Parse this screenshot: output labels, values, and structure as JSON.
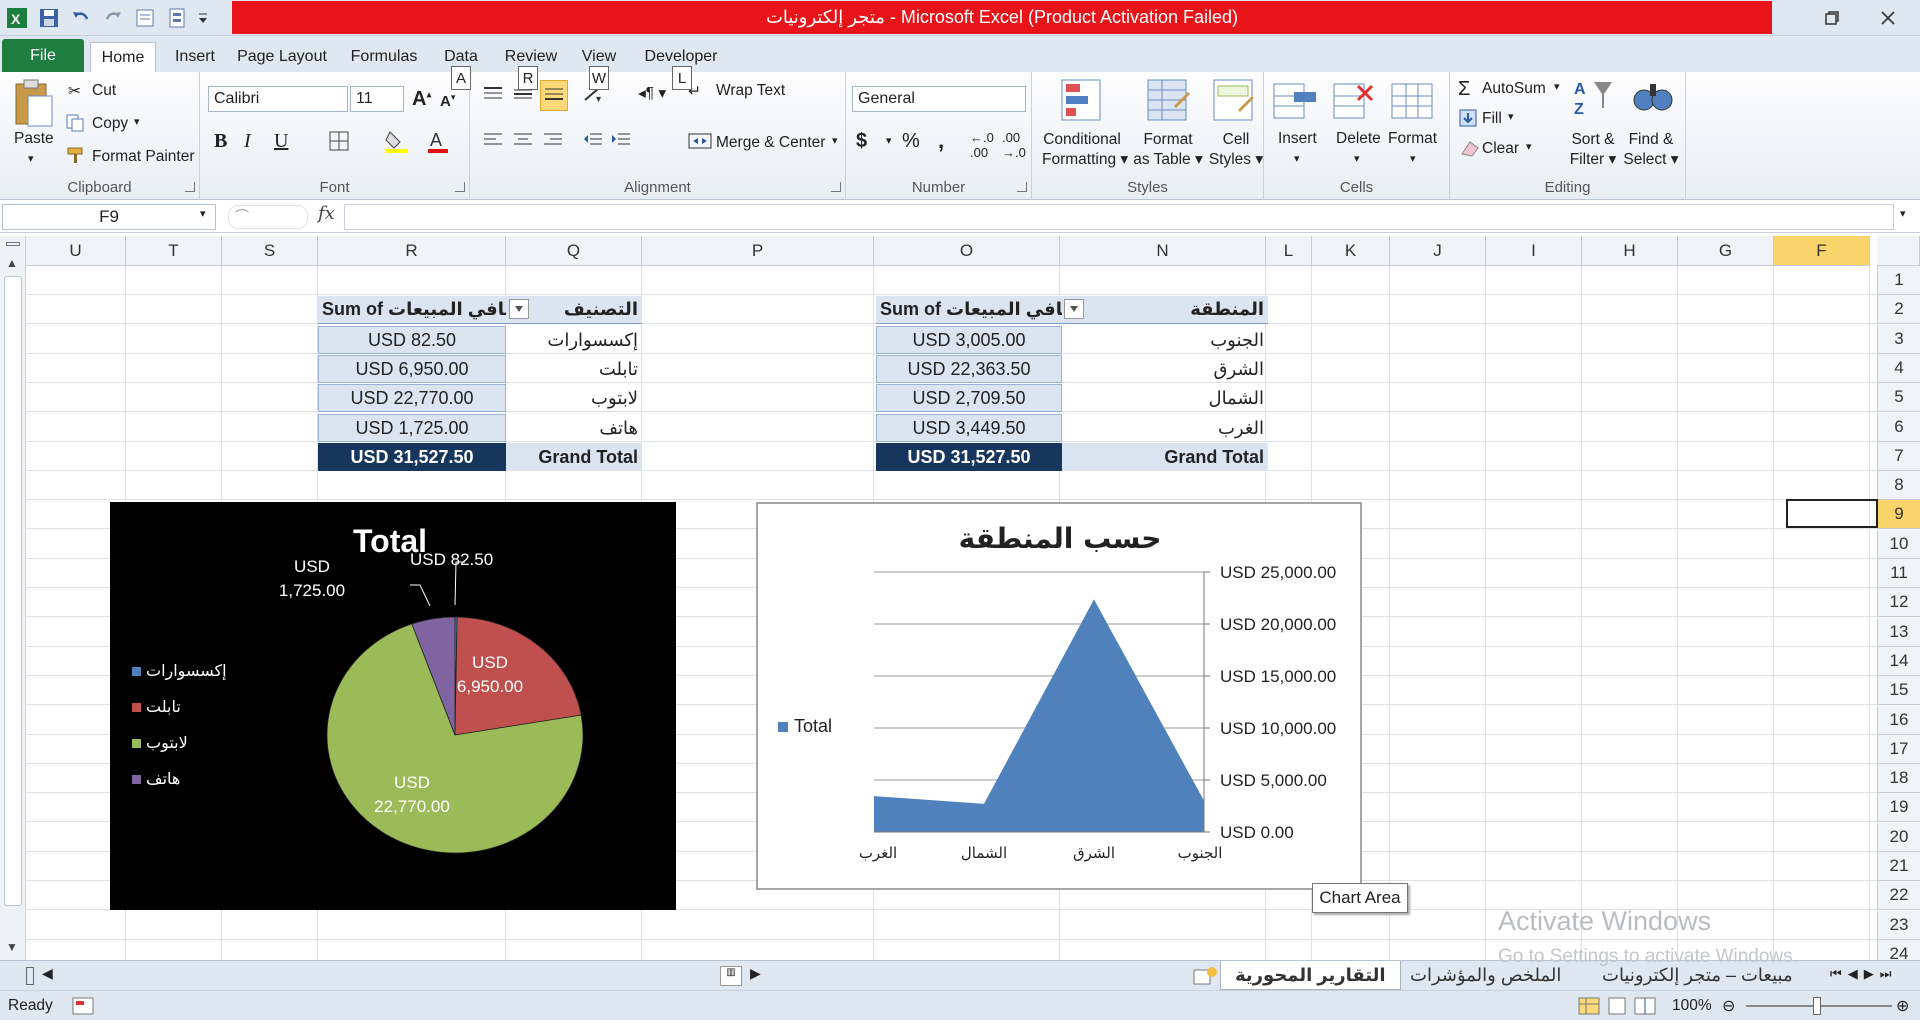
{
  "window": {
    "title": "متجر إلكترونيات  -  Microsoft Excel (Product Activation Failed)"
  },
  "ribbon_tabs": [
    "File",
    "Home",
    "Insert",
    "Page Layout",
    "Formulas",
    "Data",
    "Review",
    "View",
    "Developer"
  ],
  "keytips": [
    "A",
    "R",
    "W",
    "L"
  ],
  "clipboard": {
    "paste": "Paste",
    "cut": "Cut",
    "copy": "Copy",
    "format_painter": "Format Painter",
    "label": "Clipboard"
  },
  "font": {
    "name": "Calibri",
    "size": "11",
    "bold": "B",
    "italic": "I",
    "underline": "U",
    "label": "Font"
  },
  "alignment": {
    "wrap": "Wrap Text",
    "merge": "Merge & Center",
    "label": "Alignment"
  },
  "number": {
    "format": "General",
    "currency": "$",
    "percent": "%",
    "comma": ",",
    "label": "Number"
  },
  "styles": {
    "conditional": [
      "Conditional",
      "Formatting"
    ],
    "format_table": [
      "Format",
      "as Table"
    ],
    "cell_styles": [
      "Cell",
      "Styles"
    ],
    "label": "Styles"
  },
  "cells": {
    "insert": "Insert",
    "delete": "Delete",
    "format": "Format",
    "label": "Cells"
  },
  "editing": {
    "autosum": "AutoSum",
    "fill": "Fill",
    "clear": "Clear",
    "sort": [
      "Sort &",
      "Filter"
    ],
    "find": [
      "Find &",
      "Select"
    ],
    "label": "Editing"
  },
  "formula_bar": {
    "name_box": "F9",
    "fx": "fx",
    "value": ""
  },
  "columns": [
    "U",
    "T",
    "S",
    "R",
    "Q",
    "P",
    "O",
    "N",
    "L",
    "K",
    "J",
    "I",
    "H",
    "G",
    "F"
  ],
  "rows": [
    "1",
    "2",
    "3",
    "4",
    "5",
    "6",
    "7",
    "8",
    "9",
    "10",
    "11",
    "12",
    "13",
    "14",
    "15",
    "16",
    "17",
    "18",
    "19",
    "20",
    "21",
    "22",
    "23",
    "24"
  ],
  "pivot_category": {
    "header_label": "التصنيف",
    "header_value": "Sum of صافي المبيعات",
    "rows": [
      {
        "label": "إكسسوارات",
        "value": "USD 82.50"
      },
      {
        "label": "تابلت",
        "value": "USD 6,950.00"
      },
      {
        "label": "لابتوب",
        "value": "USD 22,770.00"
      },
      {
        "label": "هاتف",
        "value": "USD 1,725.00"
      }
    ],
    "total_label": "Grand Total",
    "total_value": "USD 31,527.50"
  },
  "pivot_region": {
    "header_label": "المنطقة",
    "header_value": "Sum of صافي المبيعات",
    "rows": [
      {
        "label": "الجنوب",
        "value": "USD 3,005.00"
      },
      {
        "label": "الشرق",
        "value": "USD 22,363.50"
      },
      {
        "label": "الشمال",
        "value": "USD 2,709.50"
      },
      {
        "label": "الغرب",
        "value": "USD 3,449.50"
      }
    ],
    "total_label": "Grand Total",
    "total_value": "USD 31,527.50"
  },
  "chart_data": [
    {
      "type": "pie",
      "title": "Total",
      "categories": [
        "إكسسوارات",
        "تابلت",
        "لابتوب",
        "هاتف"
      ],
      "values": [
        82.5,
        6950,
        22770,
        1725
      ],
      "data_labels": [
        "USD 82.50",
        "USD 6,950.00",
        "USD 22,770.00",
        "USD 1,725.00"
      ],
      "colors": [
        "#4f81bd",
        "#c0504d",
        "#9bbb59",
        "#8064a2"
      ],
      "legend": "left",
      "background": "#000000"
    },
    {
      "type": "area",
      "title": "حسب المنطقة",
      "categories": [
        "الغرب",
        "الشمال",
        "الشرق",
        "الجنوب"
      ],
      "series": [
        {
          "name": "Total",
          "values": [
            3449.5,
            2709.5,
            22363.5,
            3005
          ]
        }
      ],
      "ylim": [
        0,
        25000
      ],
      "yticks": [
        "USD 0.00",
        "USD 5,000.00",
        "USD 10,000.00",
        "USD 15,000.00",
        "USD 20,000.00",
        "USD 25,000.00"
      ],
      "grid": true,
      "legend": "left",
      "color": "#4f81bd"
    }
  ],
  "tooltip": "Chart Area",
  "sheet_tabs": [
    "التقارير المحورية",
    "الملخص والمؤشرات",
    "مبيعات – متجر إلكترونيات"
  ],
  "status": {
    "ready": "Ready",
    "zoom": "100%"
  },
  "watermark": {
    "line1": "Activate Windows",
    "line2": "Go to Settings to activate Windows."
  }
}
